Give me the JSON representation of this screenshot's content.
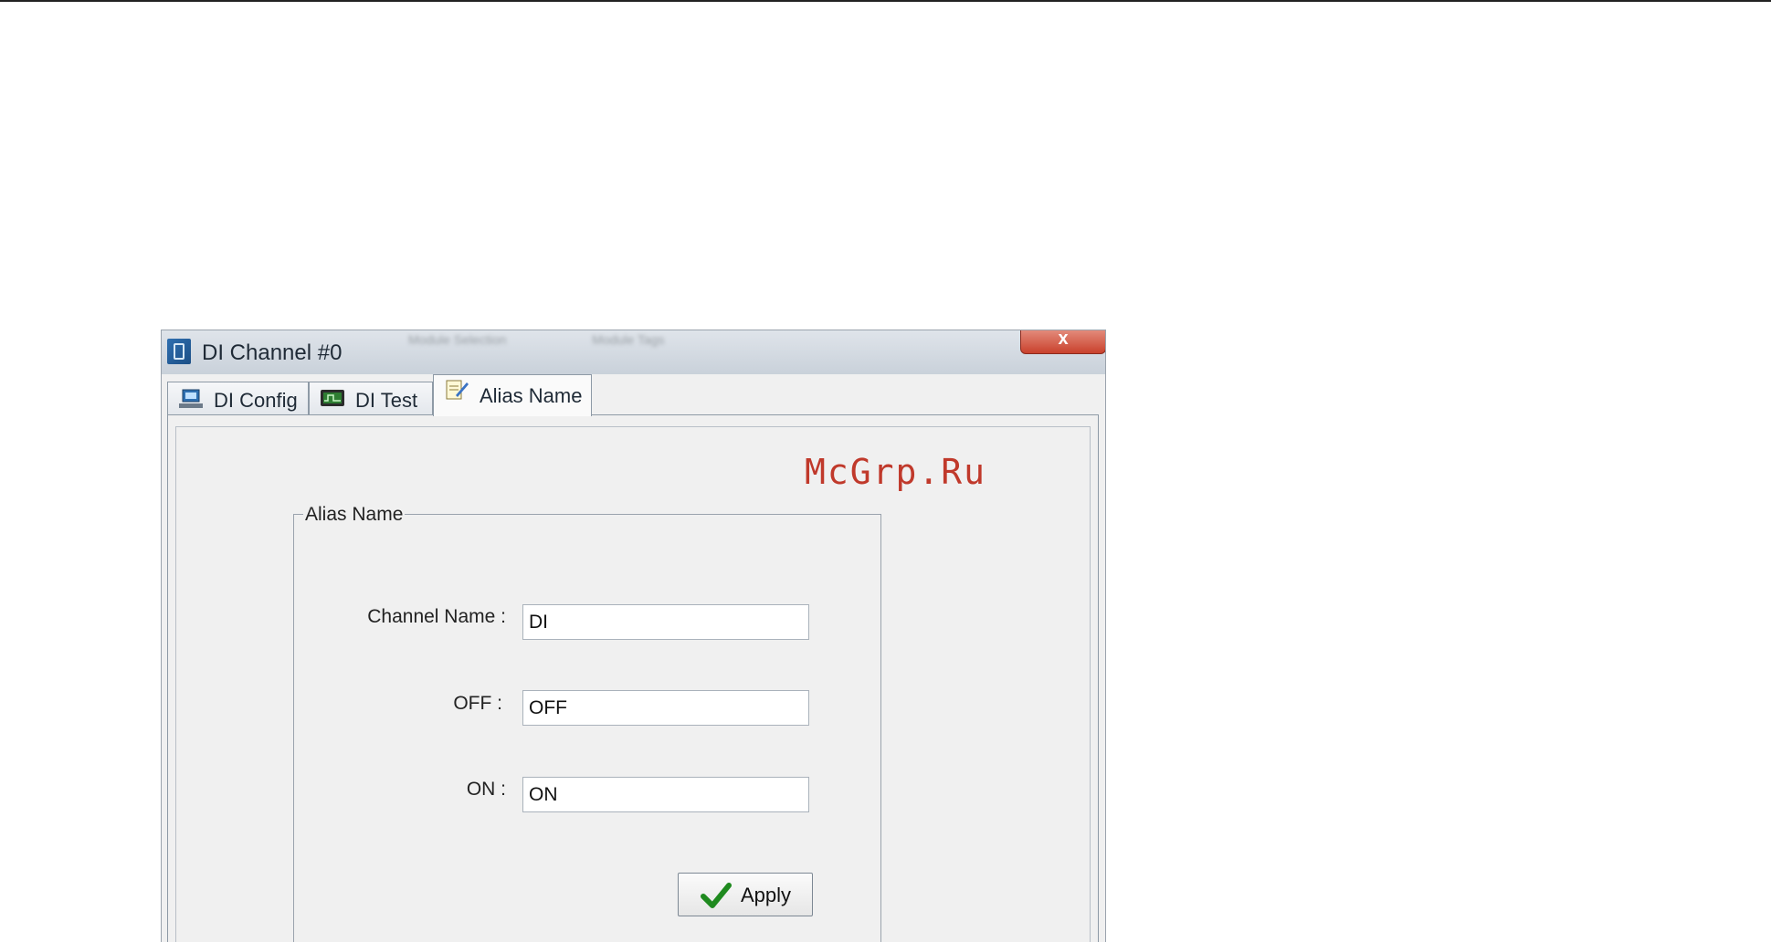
{
  "window": {
    "title": "DI Channel #0",
    "close_label": "x",
    "background_tabs": [
      "Module Selection",
      "Module Tags"
    ]
  },
  "tabs": [
    {
      "label": "DI Config",
      "icon": "network-config-icon",
      "active": false
    },
    {
      "label": "DI Test",
      "icon": "monitor-test-icon",
      "active": false
    },
    {
      "label": "Alias Name",
      "icon": "notepad-edit-icon",
      "active": true
    }
  ],
  "watermark": "McGrp.Ru",
  "alias_group": {
    "legend": "Alias Name",
    "fields": [
      {
        "label": "Channel Name :",
        "value": "DI"
      },
      {
        "label": "OFF :",
        "value": "OFF"
      },
      {
        "label": "ON :",
        "value": "ON"
      }
    ],
    "apply_label": "Apply"
  },
  "colors": {
    "watermark": "#c0392b",
    "close_button": "#c9412c",
    "check_icon": "#1f8a1f"
  }
}
